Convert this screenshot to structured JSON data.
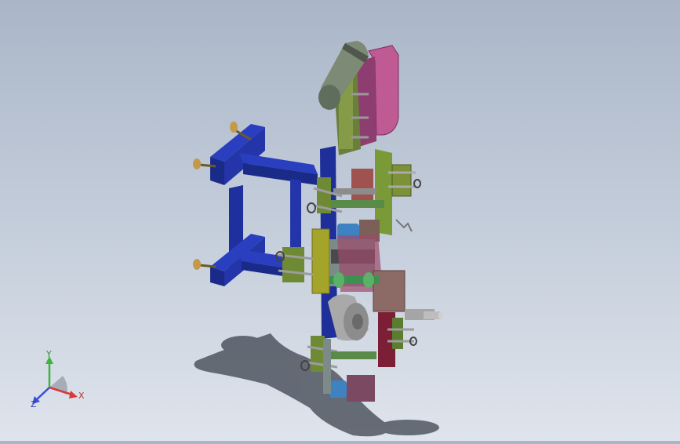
{
  "view": {
    "background_top": "#aab6c8",
    "background_bottom": "#dfe4ec"
  },
  "model": {
    "colors": {
      "frame": "#1f2f9a",
      "frame_light": "#3d4fd0",
      "plate_green": "#6b8f2d",
      "plate_pink": "#b0508a",
      "plate_olive": "#a4a32a",
      "shaft": "#a7a7a7",
      "block_blue": "#3c7fbf",
      "block_brown": "#8a6b63",
      "shadow": "#404652"
    },
    "part_icons": [
      "leveling-foot-icon",
      "eye-bolt-icon"
    ]
  },
  "triad": {
    "x_label": "X",
    "y_label": "Y",
    "z_label": "Z",
    "x_color": "#d63a3a",
    "y_color": "#3fb23f",
    "z_color": "#3a4fd6"
  }
}
